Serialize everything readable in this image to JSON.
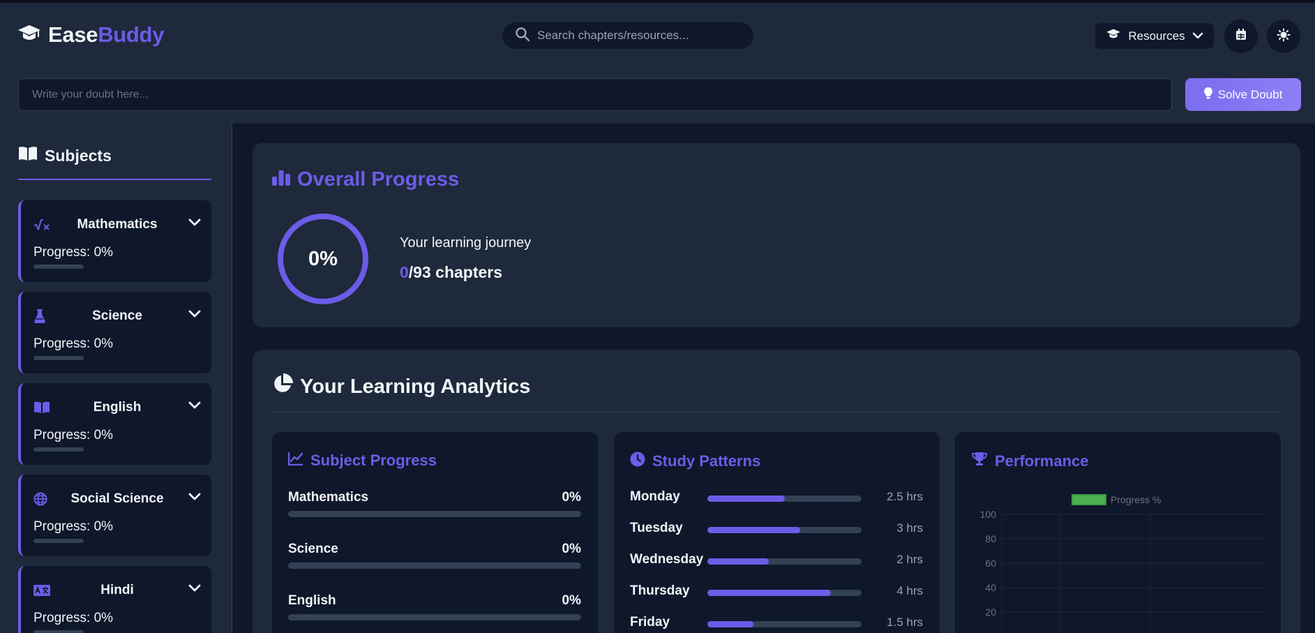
{
  "header": {
    "brand_main": "Ease",
    "brand_accent": "Buddy",
    "search_placeholder": "Search chapters/resources...",
    "resources_label": "Resources",
    "doubt_placeholder": "Write your doubt here...",
    "solve_label": "Solve Doubt"
  },
  "sidebar": {
    "title": "Subjects",
    "subjects": [
      {
        "name": "Mathematics",
        "icon": "square-root-icon",
        "progress_label": "Progress: 0%",
        "progress": 0
      },
      {
        "name": "Science",
        "icon": "flask-icon",
        "progress_label": "Progress: 0%",
        "progress": 0
      },
      {
        "name": "English",
        "icon": "book-icon",
        "progress_label": "Progress: 0%",
        "progress": 0
      },
      {
        "name": "Social Science",
        "icon": "globe-icon",
        "progress_label": "Progress: 0%",
        "progress": 0
      },
      {
        "name": "Hindi",
        "icon": "language-icon",
        "progress_label": "Progress: 0%",
        "progress": 0
      }
    ]
  },
  "overall": {
    "title": "Overall Progress",
    "percent": "0%",
    "journey": "Your learning journey",
    "completed": "0",
    "total": "/93 chapters"
  },
  "analytics": {
    "title": "Your Learning Analytics",
    "subject_progress": {
      "title": "Subject Progress",
      "items": [
        {
          "name": "Mathematics",
          "value": "0%"
        },
        {
          "name": "Science",
          "value": "0%"
        },
        {
          "name": "English",
          "value": "0%"
        }
      ]
    },
    "study_patterns": {
      "title": "Study Patterns",
      "items": [
        {
          "day": "Monday",
          "hours_label": "2.5 hrs",
          "fill": 0.5
        },
        {
          "day": "Tuesday",
          "hours_label": "3 hrs",
          "fill": 0.6
        },
        {
          "day": "Wednesday",
          "hours_label": "2 hrs",
          "fill": 0.4
        },
        {
          "day": "Thursday",
          "hours_label": "4 hrs",
          "fill": 0.8
        },
        {
          "day": "Friday",
          "hours_label": "1.5 hrs",
          "fill": 0.3
        }
      ]
    },
    "performance": {
      "title": "Performance"
    }
  },
  "chart_data": {
    "type": "bar",
    "series": [
      {
        "name": "Progress %",
        "values": []
      }
    ],
    "ylim": [
      0,
      100
    ],
    "yticks": [
      "100",
      "80",
      "60",
      "40",
      "20"
    ],
    "grid": true,
    "legend": "top",
    "series_color": "#4caf50"
  },
  "colors": {
    "accent": "#6c5ce7",
    "background": "#0f172a",
    "panel": "#1e293b"
  }
}
